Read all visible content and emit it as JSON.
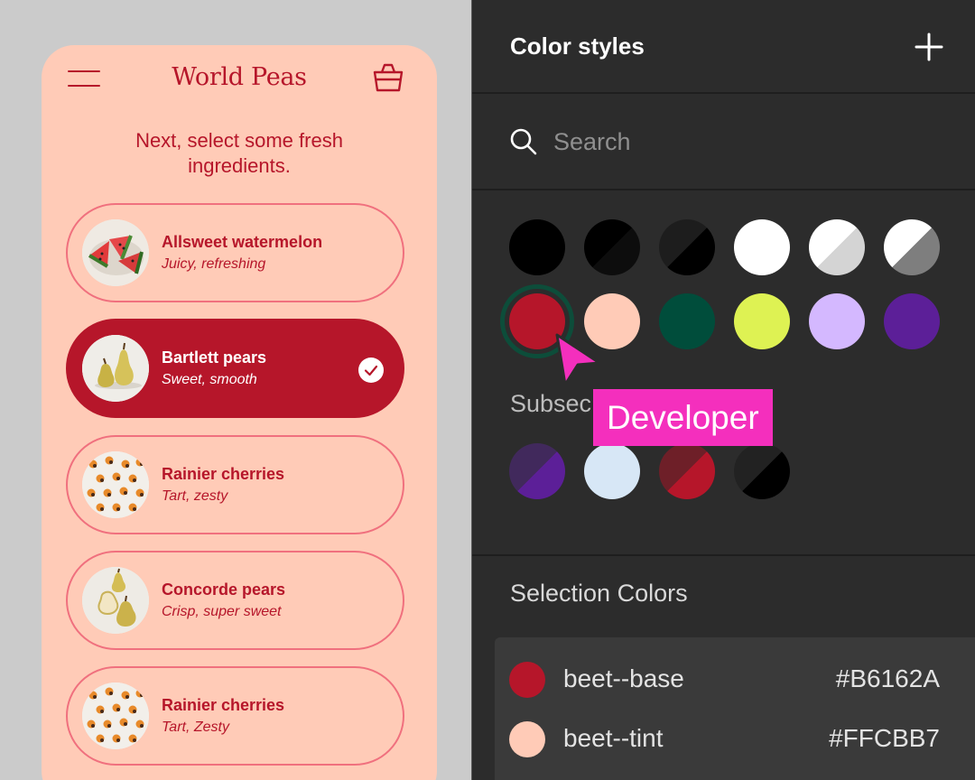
{
  "app": {
    "brand": "World Peas",
    "prompt": "Next, select some fresh ingredients.",
    "items": [
      {
        "name": "Allsweet watermelon",
        "desc": "Juicy, refreshing",
        "selected": false,
        "image": "watermelon"
      },
      {
        "name": "Bartlett pears",
        "desc": "Sweet, smooth",
        "selected": true,
        "image": "pears"
      },
      {
        "name": "Rainier cherries",
        "desc": "Tart, zesty",
        "selected": false,
        "image": "cherries"
      },
      {
        "name": "Concorde pears",
        "desc": "Crisp, super sweet",
        "selected": false,
        "image": "pears"
      },
      {
        "name": "Rainier cherries",
        "desc": "Tart, Zesty",
        "selected": false,
        "image": "cherries"
      }
    ]
  },
  "panel": {
    "title": "Color styles",
    "search_placeholder": "Search",
    "subsection_label": "Subsec",
    "selection_title": "Selection Colors",
    "developer_tag": "Developer",
    "colors": {
      "beet_base": "#B6162A",
      "beet_tint": "#FFCBB7",
      "accent_pink": "#F42FBD"
    },
    "selection_colors": [
      {
        "name": "beet--base",
        "hex": "#B6162A"
      },
      {
        "name": "beet--tint",
        "hex": "#FFCBB7"
      }
    ]
  }
}
